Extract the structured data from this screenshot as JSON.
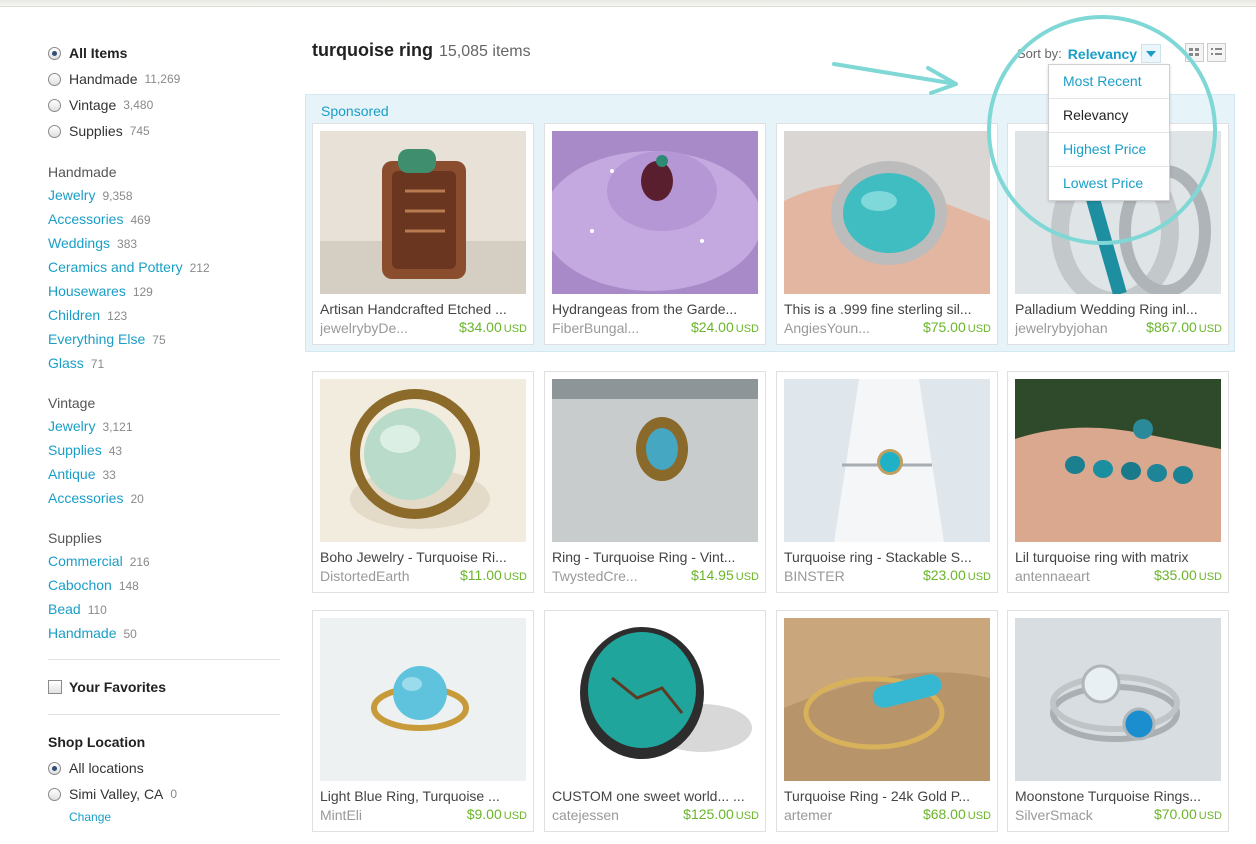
{
  "filters": {
    "items": [
      {
        "label": "All Items",
        "count": "",
        "selected": true
      },
      {
        "label": "Handmade",
        "count": "11,269",
        "selected": false
      },
      {
        "label": "Vintage",
        "count": "3,480",
        "selected": false
      },
      {
        "label": "Supplies",
        "count": "745",
        "selected": false
      }
    ]
  },
  "categories": {
    "handmade": {
      "title": "Handmade",
      "links": [
        {
          "label": "Jewelry",
          "count": "9,358"
        },
        {
          "label": "Accessories",
          "count": "469"
        },
        {
          "label": "Weddings",
          "count": "383"
        },
        {
          "label": "Ceramics and Pottery",
          "count": "212"
        },
        {
          "label": "Housewares",
          "count": "129"
        },
        {
          "label": "Children",
          "count": "123"
        },
        {
          "label": "Everything Else",
          "count": "75"
        },
        {
          "label": "Glass",
          "count": "71"
        }
      ]
    },
    "vintage": {
      "title": "Vintage",
      "links": [
        {
          "label": "Jewelry",
          "count": "3,121"
        },
        {
          "label": "Supplies",
          "count": "43"
        },
        {
          "label": "Antique",
          "count": "33"
        },
        {
          "label": "Accessories",
          "count": "20"
        }
      ]
    },
    "supplies": {
      "title": "Supplies",
      "links": [
        {
          "label": "Commercial",
          "count": "216"
        },
        {
          "label": "Cabochon",
          "count": "148"
        },
        {
          "label": "Bead",
          "count": "110"
        },
        {
          "label": "Handmade",
          "count": "50"
        }
      ]
    }
  },
  "favorites": {
    "label": "Your Favorites"
  },
  "shop_location": {
    "title": "Shop Location",
    "options": [
      {
        "label": "All locations",
        "count": "",
        "selected": true
      },
      {
        "label": "Simi Valley, CA",
        "count": "0",
        "selected": false
      }
    ],
    "change_label": "Change"
  },
  "search": {
    "query": "turquoise ring",
    "count": "15,085 items"
  },
  "sort": {
    "label": "Sort by:",
    "value": "Relevancy",
    "options": [
      "Most Recent",
      "Relevancy",
      "Highest Price",
      "Lowest Price"
    ],
    "active": "Relevancy"
  },
  "sponsored_label": "Sponsored",
  "currency": "USD",
  "colors": {
    "link": "#1a9ec7",
    "price": "#6ab52a",
    "annotation": "#7fd8d6",
    "sponsored_bg": "#e6f3f8"
  },
  "listings": [
    {
      "title": "Artisan Handcrafted Etched ...",
      "shop": "jewelrybyDe...",
      "price": "$34.00",
      "sponsored": true
    },
    {
      "title": "Hydrangeas from the Garde...",
      "shop": "FiberBungal...",
      "price": "$24.00",
      "sponsored": true
    },
    {
      "title": "This is a .999 fine sterling sil...",
      "shop": "AngiesYoun...",
      "price": "$75.00",
      "sponsored": true
    },
    {
      "title": "Palladium Wedding Ring inl...",
      "shop": "jewelrybyjohan",
      "price": "$867.00",
      "sponsored": true
    },
    {
      "title": "Boho Jewelry - Turquoise Ri...",
      "shop": "DistortedEarth",
      "price": "$11.00",
      "sponsored": false
    },
    {
      "title": "Ring - Turquoise Ring - Vint...",
      "shop": "TwystedCre...",
      "price": "$14.95",
      "sponsored": false
    },
    {
      "title": "Turquoise ring - Stackable S...",
      "shop": "BINSTER",
      "price": "$23.00",
      "sponsored": false
    },
    {
      "title": "Lil turquoise ring with matrix",
      "shop": "antennaeart",
      "price": "$35.00",
      "sponsored": false
    },
    {
      "title": "Light Blue Ring, Turquoise ...",
      "shop": "MintEli",
      "price": "$9.00",
      "sponsored": false
    },
    {
      "title": "CUSTOM one sweet world... ...",
      "shop": "catejessen",
      "price": "$125.00",
      "sponsored": false
    },
    {
      "title": "Turquoise Ring - 24k Gold P...",
      "shop": "artemer",
      "price": "$68.00",
      "sponsored": false
    },
    {
      "title": "Moonstone Turquoise Rings...",
      "shop": "SilverSmack",
      "price": "$70.00",
      "sponsored": false
    }
  ]
}
